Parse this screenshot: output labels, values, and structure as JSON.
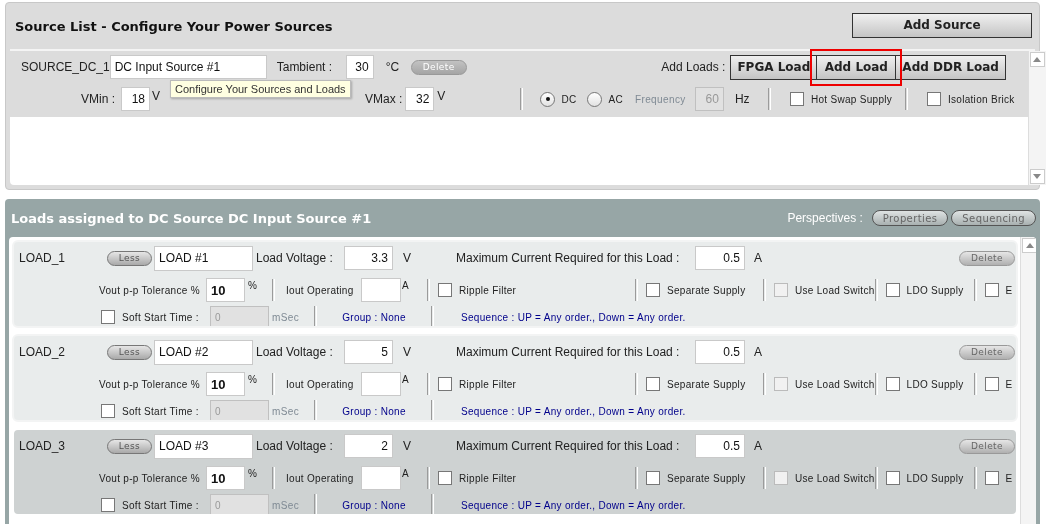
{
  "source_panel": {
    "title": "Source List - Configure Your Power Sources",
    "add_button": "Add Source",
    "source": {
      "id": "SOURCE_DC_1",
      "name": "DC Input Source #1",
      "tambient_label": "Tambient :",
      "tambient": "30",
      "tambient_unit": "°C",
      "delete": "Delete",
      "add_loads_label": "Add Loads :",
      "load_buttons": [
        {
          "label": "FPGA Load",
          "highlighted": false
        },
        {
          "label": "Add Load",
          "highlighted": true
        },
        {
          "label": "Add DDR Load",
          "highlighted": false
        }
      ],
      "vmin_label": "VMin :",
      "vmin": "18",
      "vmin_unit": "V",
      "vmax_label": "VMax :",
      "vmax": "32",
      "vmax_unit": "V",
      "supply_types": [
        {
          "label": "DC",
          "selected": true
        },
        {
          "label": "AC",
          "selected": false
        }
      ],
      "frequency": {
        "label": "Frequency",
        "value": "60",
        "unit": "Hz",
        "disabled": true
      },
      "options": [
        {
          "label": "Hot Swap Supply",
          "checked": false
        },
        {
          "label": "Isolation Brick",
          "checked": false
        }
      ]
    },
    "tooltip": "Configure Your Sources and Loads"
  },
  "loads_panel": {
    "title": "Loads assigned to DC Source DC Input Source #1",
    "perspectives_label": "Perspectives :",
    "perspectives": [
      "Properties",
      "Sequencing"
    ],
    "loads": [
      {
        "id": "LOAD_1",
        "selected": false,
        "toggle": "Less",
        "name": "LOAD #1",
        "voltage_label": "Load Voltage :",
        "voltage": "3.3",
        "voltage_unit": "V",
        "current_label": "Maximum Current Required for this Load :",
        "current": "0.5",
        "current_unit": "A",
        "delete": "Delete",
        "tolerance_label": "Vout p-p Tolerance %",
        "tolerance": "10",
        "tolerance_unit": "%",
        "iout_label": "Iout Operating",
        "iout_unit": "A",
        "options": [
          {
            "label": "Ripple Filter",
            "checked": false,
            "disabled": false
          },
          {
            "label": "Separate Supply",
            "checked": false,
            "disabled": false
          },
          {
            "label": "Use Load Switch",
            "checked": false,
            "disabled": true
          },
          {
            "label": "LDO Supply",
            "checked": false,
            "disabled": false
          },
          {
            "label": "E",
            "checked": false,
            "disabled": false
          }
        ],
        "soft_start": {
          "label": "Soft Start Time :",
          "checked": false,
          "value": "0",
          "unit": "mSec",
          "disabled": true
        },
        "group": "Group : None",
        "sequence": "Sequence : UP = Any order., Down = Any order."
      },
      {
        "id": "LOAD_2",
        "selected": false,
        "toggle": "Less",
        "name": "LOAD #2",
        "voltage_label": "Load Voltage :",
        "voltage": "5",
        "voltage_unit": "V",
        "current_label": "Maximum Current Required for this Load :",
        "current": "0.5",
        "current_unit": "A",
        "delete": "Delete",
        "tolerance_label": "Vout p-p Tolerance %",
        "tolerance": "10",
        "tolerance_unit": "%",
        "iout_label": "Iout Operating",
        "iout_unit": "A",
        "options": [
          {
            "label": "Ripple Filter",
            "checked": false,
            "disabled": false
          },
          {
            "label": "Separate Supply",
            "checked": false,
            "disabled": false
          },
          {
            "label": "Use Load Switch",
            "checked": false,
            "disabled": true
          },
          {
            "label": "LDO Supply",
            "checked": false,
            "disabled": false
          },
          {
            "label": "E",
            "checked": false,
            "disabled": false
          }
        ],
        "soft_start": {
          "label": "Soft Start Time :",
          "checked": false,
          "value": "0",
          "unit": "mSec",
          "disabled": true
        },
        "group": "Group : None",
        "sequence": "Sequence : UP = Any order., Down = Any order."
      },
      {
        "id": "LOAD_3",
        "selected": true,
        "toggle": "Less",
        "name": "LOAD #3",
        "voltage_label": "Load Voltage :",
        "voltage": "2",
        "voltage_unit": "V",
        "current_label": "Maximum Current Required for this Load :",
        "current": "0.5",
        "current_unit": "A",
        "delete": "Delete",
        "tolerance_label": "Vout p-p Tolerance %",
        "tolerance": "10",
        "tolerance_unit": "%",
        "iout_label": "Iout Operating",
        "iout_unit": "A",
        "options": [
          {
            "label": "Ripple Filter",
            "checked": false,
            "disabled": false
          },
          {
            "label": "Separate Supply",
            "checked": false,
            "disabled": false
          },
          {
            "label": "Use Load Switch",
            "checked": false,
            "disabled": true
          },
          {
            "label": "LDO Supply",
            "checked": false,
            "disabled": false
          },
          {
            "label": "E",
            "checked": false,
            "disabled": false
          }
        ],
        "soft_start": {
          "label": "Soft Start Time :",
          "checked": false,
          "value": "0",
          "unit": "mSec",
          "disabled": true
        },
        "group": "Group : None",
        "sequence": "Sequence : UP = Any order., Down = Any order."
      }
    ]
  }
}
